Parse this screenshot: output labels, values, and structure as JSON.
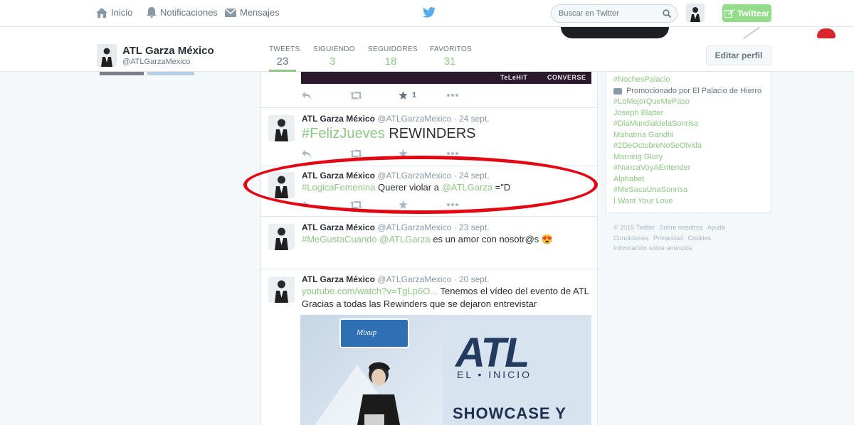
{
  "nav": {
    "home": "Inicio",
    "notifications": "Notificaciones",
    "messages": "Mensajes",
    "search_placeholder": "Buscar en Twitter",
    "tweet_button": "Twittear"
  },
  "profile": {
    "name": "ATL Garza México",
    "handle": "@ATLGarzaMexico",
    "stats": [
      {
        "label": "TWEETS",
        "value": "23"
      },
      {
        "label": "SIGUIENDO",
        "value": "3"
      },
      {
        "label": "SEGUIDORES",
        "value": "18"
      },
      {
        "label": "FAVORITOS",
        "value": "31"
      }
    ],
    "edit_button": "Editar perfil"
  },
  "media_top": {
    "left_text": "TeLeHiT",
    "right_text": "CONVERSE"
  },
  "tweets": [
    {
      "fav_count": "1"
    },
    {
      "name": "ATL Garza México",
      "handle": "@ATLGarzaMexico",
      "date": "· 24 sept.",
      "hashtag": "#FelizJueves",
      "text": " REWINDERS"
    },
    {
      "name": "ATL Garza México",
      "handle": "@ATLGarzaMexico",
      "date": "· 24 sept.",
      "hashtag": "#LogicaFemenina",
      "text1": " Querer violar a ",
      "mention": "@ATLGarza",
      "text2": " =\"D"
    },
    {
      "name": "ATL Garza México",
      "handle": "@ATLGarzaMexico",
      "date": "· 23 sept.",
      "hashtag": "#MeGustaCuando",
      "mention": "@ATLGarza",
      "text": " es un amor con nosotr@s 😍"
    },
    {
      "name": "ATL Garza México",
      "handle": "@ATLGarzaMexico",
      "date": "· 20 sept.",
      "link": "youtube.com/watch?v=TgLp6O...",
      "text1": " Tenemos el vídeo del evento de ATL",
      "text2": "Gracias a todas las Rewinders que se dejaron entrevistar"
    }
  ],
  "promo_card": {
    "brand": "Mixup",
    "title": "ATL",
    "subtitle": "EL • INICIO",
    "showcase": "SHOWCASE Y"
  },
  "trends": {
    "items_before_promo": [
      "#NochesPalacio"
    ],
    "promoted": "Promocionado por El Palacio de Hierro",
    "items": [
      "#LoMejorQueMePaso",
      "Joseph Blatter",
      "#DiaMundialdelaSonrisa",
      "Mahatma Gandhi",
      "#2DeOctubreNoSeOlvida",
      "Morning Glory",
      "#NuncaVoyAEntender",
      "Alphabet",
      "#MeSacaUnaSonrisa",
      "I Want Your Love"
    ]
  },
  "footer": {
    "line1": [
      "© 2015 Twitter",
      "Sobre nosotros",
      "Ayuda"
    ],
    "line2": [
      "Condiciones",
      "Privacidad",
      "Cookies"
    ],
    "line3": [
      "Información sobre anuncios"
    ]
  },
  "colors": {
    "accent": "#8ec883",
    "highlight_ellipse": "#e30613",
    "tweet_button": "#93dc8a"
  }
}
